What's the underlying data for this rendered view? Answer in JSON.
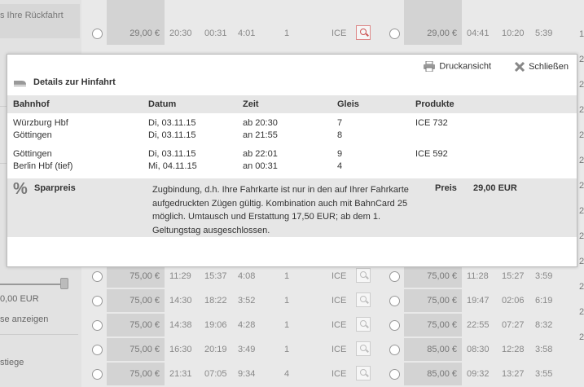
{
  "sidebar": {
    "return_header": "s Ihre Rückfahrt",
    "price_label": "0,00 EUR",
    "show_label": "se anzeigen",
    "steps_label": "stiege"
  },
  "colors": {
    "accent": "#cc0000",
    "header_bg": "#d3d3d3",
    "table_header_bg": "#e6e6e6"
  },
  "outbound_rows": [
    {
      "price": "29,00 €",
      "dep": "20:30",
      "arr": "00:31",
      "dur": "4:01",
      "changes": "1",
      "product": "ICE",
      "icon": "magnifier-icon",
      "active": true
    },
    {
      "price": "75,00 €",
      "dep": "11:29",
      "arr": "15:37",
      "dur": "4:08",
      "changes": "1",
      "product": "ICE",
      "icon": "magnifier-icon"
    },
    {
      "price": "75,00 €",
      "dep": "14:30",
      "arr": "18:22",
      "dur": "3:52",
      "changes": "1",
      "product": "ICE",
      "icon": "magnifier-icon"
    },
    {
      "price": "75,00 €",
      "dep": "14:38",
      "arr": "19:06",
      "dur": "4:28",
      "changes": "1",
      "product": "ICE",
      "icon": "magnifier-icon"
    },
    {
      "price": "75,00 €",
      "dep": "16:30",
      "arr": "20:19",
      "dur": "3:49",
      "changes": "1",
      "product": "ICE",
      "icon": "magnifier-icon"
    },
    {
      "price": "75,00 €",
      "dep": "21:31",
      "arr": "07:05",
      "dur": "9:34",
      "changes": "4",
      "product": "ICE",
      "icon": "magnifier-icon"
    }
  ],
  "return_rows": [
    {
      "price": "29,00 €",
      "dep": "04:41",
      "arr": "10:20",
      "dur": "5:39"
    },
    {
      "price": "75,00 €",
      "dep": "11:28",
      "arr": "15:27",
      "dur": "3:59"
    },
    {
      "price": "75,00 €",
      "dep": "19:47",
      "arr": "02:06",
      "dur": "6:19"
    },
    {
      "price": "75,00 €",
      "dep": "22:55",
      "arr": "07:27",
      "dur": "8:32"
    },
    {
      "price": "85,00 €",
      "dep": "08:30",
      "arr": "12:28",
      "dur": "3:58"
    },
    {
      "price": "85,00 €",
      "dep": "09:32",
      "arr": "13:27",
      "dur": "3:55"
    }
  ],
  "right_edge": [
    "1",
    "2",
    "2",
    "2",
    "2",
    "2",
    "2",
    "2",
    "2",
    "2",
    "2",
    "2",
    "2"
  ],
  "overlay": {
    "print_label": "Druckansicht",
    "close_label": "Schließen",
    "title": "Details zur Hinfahrt",
    "headers": {
      "station": "Bahnhof",
      "date": "Datum",
      "time": "Zeit",
      "platform": "Gleis",
      "products": "Produkte"
    },
    "legs": [
      {
        "from": {
          "station": "Würzburg Hbf",
          "date": "Di, 03.11.15",
          "time": "ab 20:30",
          "platform": "7"
        },
        "to": {
          "station": "Göttingen",
          "date": "Di, 03.11.15",
          "time": "an 21:55",
          "platform": "8"
        },
        "product": "ICE 732"
      },
      {
        "from": {
          "station": "Göttingen",
          "date": "Di, 03.11.15",
          "time": "ab 22:01",
          "platform": "9"
        },
        "to": {
          "station": "Berlin Hbf (tief)",
          "date": "Mi, 04.11.15",
          "time": "an 00:31",
          "platform": "4"
        },
        "product": "ICE 592"
      }
    ],
    "fare": {
      "icon": "percent-icon",
      "name": "Sparpreis",
      "conditions": "Zugbindung, d.h. Ihre Fahrkarte ist nur in den auf Ihrer Fahrkarte aufgedruckten Zügen gültig. Kombination auch mit BahnCard 25 möglich. Umtausch und Erstattung 17,50 EUR; ab dem 1. Geltungstag ausgeschlossen.",
      "price_label": "Preis",
      "price": "29,00 EUR"
    }
  }
}
